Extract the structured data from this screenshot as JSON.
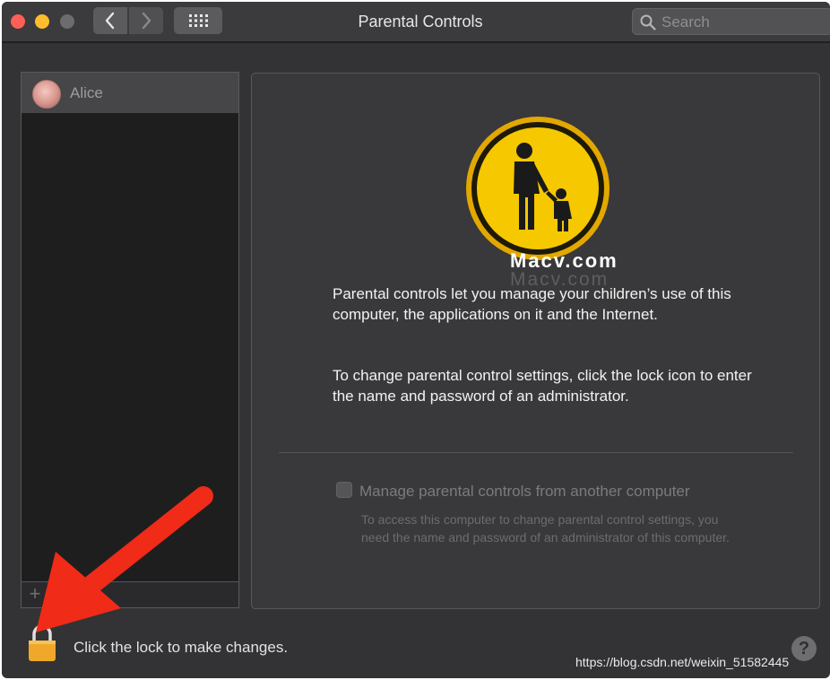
{
  "window": {
    "title": "Parental Controls"
  },
  "search": {
    "placeholder": "Search"
  },
  "sidebar": {
    "users": [
      {
        "name": "Alice"
      }
    ],
    "add_label": "+",
    "remove_label": "−"
  },
  "main": {
    "watermark": "Macv.com",
    "info_paragraph_1": "Parental controls let you manage your children’s use of this computer, the applications on it and the Internet.",
    "info_paragraph_2": "To change parental control settings, click the lock icon to enter the name and password of an administrator.",
    "remote_option": {
      "label": "Manage parental controls from another computer",
      "checked": false,
      "enabled": false,
      "description": "To access this computer to change parental control settings, you need the name and password of an administrator of this computer."
    }
  },
  "footer": {
    "lock_text": "Click the lock to make changes.",
    "help_label": "?",
    "source_url": "https://blog.csdn.net/weixin_51582445"
  },
  "colors": {
    "window_bg": "#333335",
    "icon_yellow": "#f5c800",
    "arrow_red": "#f02b18",
    "lock_orange": "#f0a82a"
  },
  "icons": [
    "search-icon",
    "parental-controls-icon",
    "lock-icon",
    "back-arrow-icon",
    "forward-arrow-icon",
    "grid-icon"
  ]
}
